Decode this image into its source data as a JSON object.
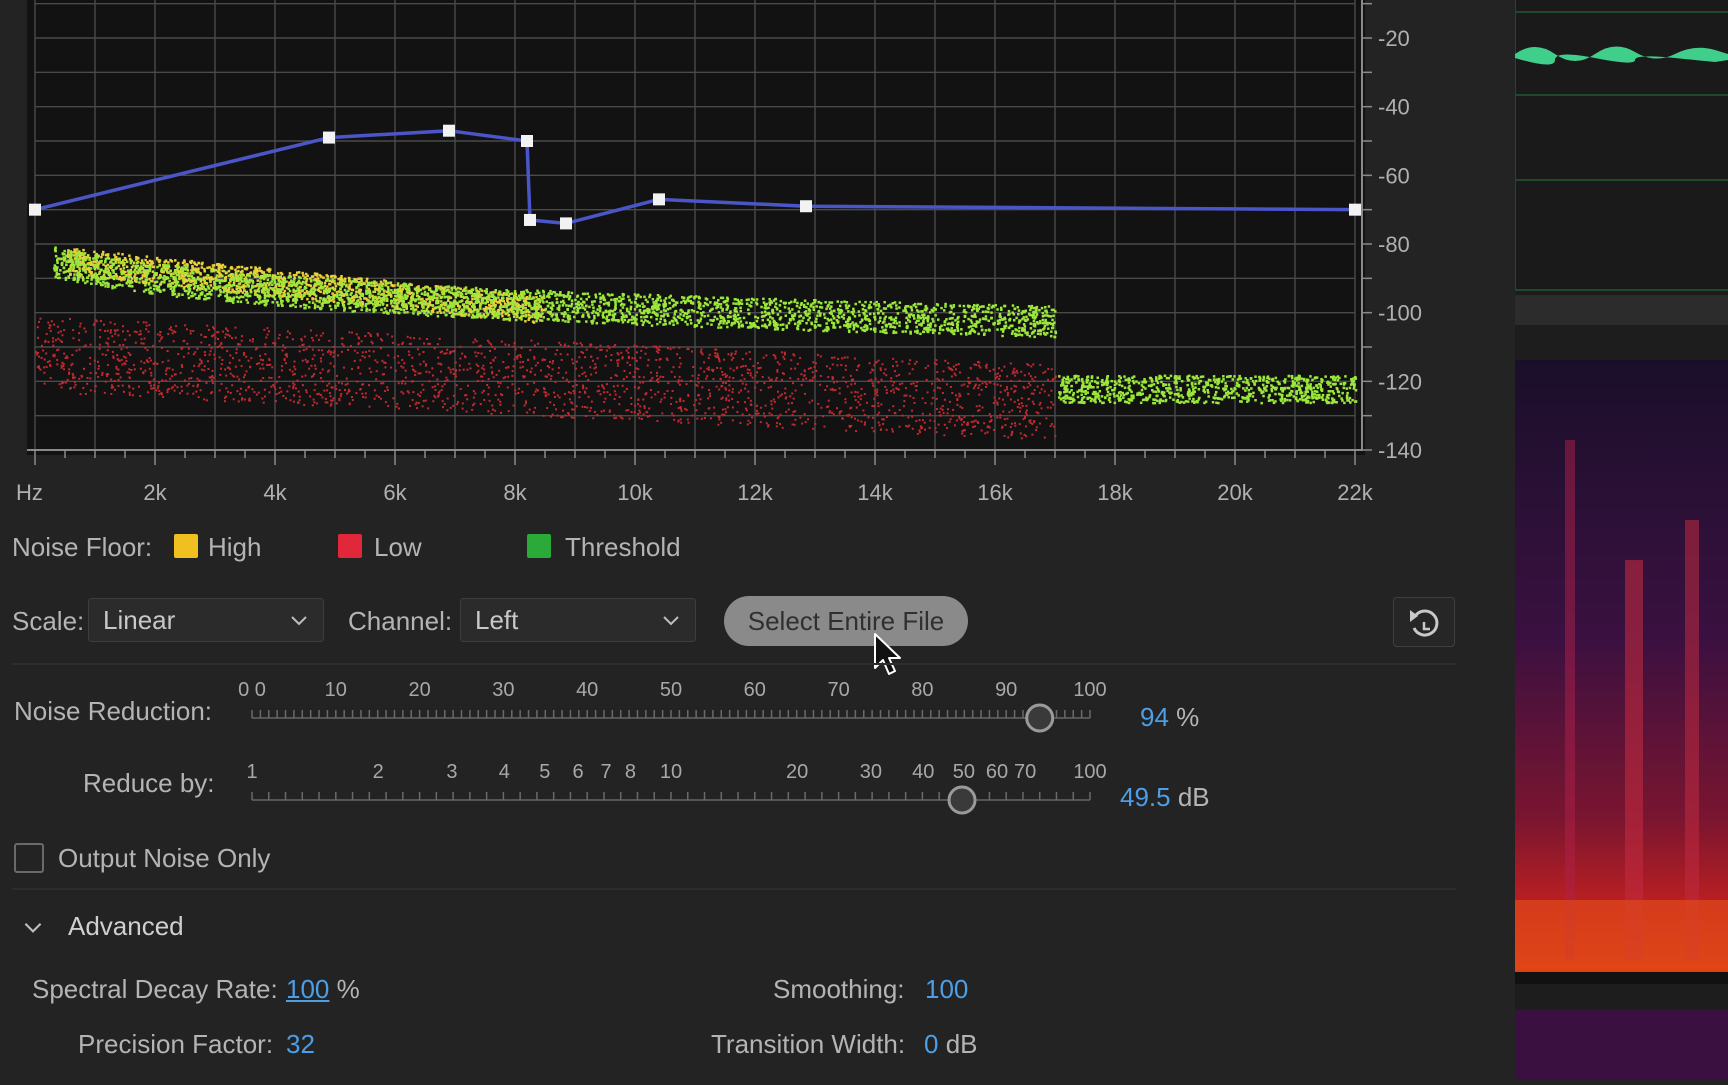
{
  "graph": {
    "y_axis_labels": [
      "-20",
      "-40",
      "-60",
      "-80",
      "-100",
      "-120",
      "-140"
    ],
    "x_axis_labels": [
      "Hz",
      "2k",
      "4k",
      "6k",
      "8k",
      "10k",
      "12k",
      "14k",
      "16k",
      "18k",
      "20k",
      "22k"
    ],
    "threshold_curve_points": [
      {
        "freq_hz": 0,
        "db": -70
      },
      {
        "freq_hz": 4900,
        "db": -49
      },
      {
        "freq_hz": 6900,
        "db": -47
      },
      {
        "freq_hz": 8200,
        "db": -50
      },
      {
        "freq_hz": 8250,
        "db": -73
      },
      {
        "freq_hz": 8850,
        "db": -74
      },
      {
        "freq_hz": 10400,
        "db": -67
      },
      {
        "freq_hz": 12850,
        "db": -69
      },
      {
        "freq_hz": 22000,
        "db": -70
      }
    ],
    "colors": {
      "curve": "#4a56c8",
      "threshold": "#9be83a",
      "high": "#e8d13a",
      "low": "#c02a30",
      "grid": "#4a4a4a"
    }
  },
  "legend": {
    "title": "Noise Floor:",
    "items": [
      {
        "label": "High",
        "color": "#f0c020"
      },
      {
        "label": "Low",
        "color": "#e0283a"
      },
      {
        "label": "Threshold",
        "color": "#2aaa38"
      }
    ]
  },
  "controls": {
    "scale_label": "Scale:",
    "scale_value": "Linear",
    "channel_label": "Channel:",
    "channel_value": "Left",
    "select_entire_file": "Select Entire File"
  },
  "noise_reduction": {
    "label": "Noise Reduction:",
    "ticks": [
      "0 0",
      "10",
      "20",
      "30",
      "40",
      "50",
      "60",
      "70",
      "80",
      "90",
      "100"
    ],
    "value": "94",
    "unit": "%"
  },
  "reduce_by": {
    "label": "Reduce by:",
    "ticks": [
      "1",
      "2",
      "3",
      "4",
      "5",
      "6",
      "7",
      "8",
      "10",
      "20",
      "30",
      "40",
      "50",
      "60",
      "70",
      "100"
    ],
    "value": "49.5",
    "unit": "dB"
  },
  "output_noise_only": {
    "label": "Output Noise Only",
    "checked": false
  },
  "advanced": {
    "label": "Advanced",
    "spectral_decay_label": "Spectral Decay Rate:",
    "spectral_decay_value": "100",
    "spectral_decay_unit": "%",
    "smoothing_label": "Smoothing:",
    "smoothing_value": "100",
    "precision_label": "Precision Factor:",
    "precision_value": "32",
    "transition_label": "Transition Width:",
    "transition_value": "0",
    "transition_unit": "dB"
  }
}
